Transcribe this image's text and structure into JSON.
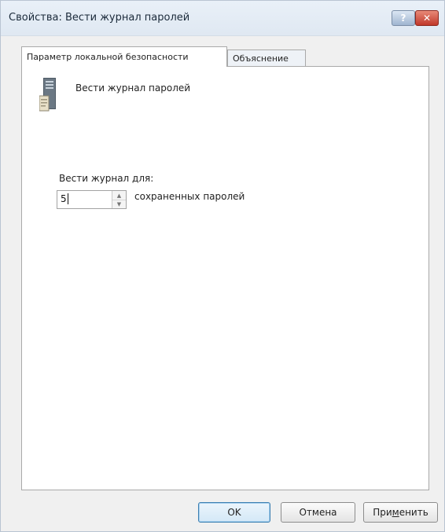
{
  "window": {
    "title": "Свойства: Вести журнал паролей",
    "help_glyph": "?",
    "close_glyph": "✕"
  },
  "tabs": [
    {
      "label": "Параметр локальной безопасности",
      "active": true
    },
    {
      "label": "Объяснение",
      "active": false
    }
  ],
  "policy": {
    "icon": "server-icon",
    "title": "Вести журнал паролей"
  },
  "history": {
    "label": "Вести журнал для:",
    "value": "5",
    "unit": "сохраненных паролей",
    "up_glyph": "▲",
    "down_glyph": "▼"
  },
  "buttons": {
    "ok": "OK",
    "cancel": "Отмена",
    "apply_prefix": "При",
    "apply_underlined": "м",
    "apply_suffix": "енить"
  },
  "colors": {
    "close_button": "#c0382a",
    "ok_border": "#3c7fb1"
  }
}
